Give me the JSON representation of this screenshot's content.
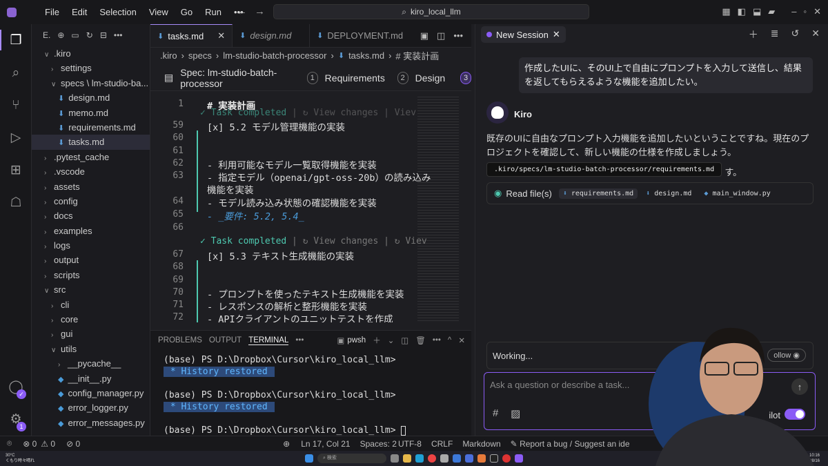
{
  "titlebar": {
    "menus": [
      "File",
      "Edit",
      "Selection",
      "View",
      "Go",
      "Run"
    ],
    "more": "•••",
    "search": "kiro_local_llm"
  },
  "explorer": {
    "header": "E.",
    "items": [
      {
        "label": ".kiro",
        "depth": 0,
        "chev": "∨"
      },
      {
        "label": "settings",
        "depth": 1,
        "chev": "›"
      },
      {
        "label": "specs \\ lm-studio-ba...",
        "depth": 1,
        "chev": "∨"
      },
      {
        "label": "design.md",
        "depth": 2,
        "icon": "md"
      },
      {
        "label": "memo.md",
        "depth": 2,
        "icon": "md"
      },
      {
        "label": "requirements.md",
        "depth": 2,
        "icon": "md"
      },
      {
        "label": "tasks.md",
        "depth": 2,
        "icon": "md",
        "selected": true
      },
      {
        "label": ".pytest_cache",
        "depth": 0,
        "chev": "›"
      },
      {
        "label": ".vscode",
        "depth": 0,
        "chev": "›"
      },
      {
        "label": "assets",
        "depth": 0,
        "chev": "›"
      },
      {
        "label": "config",
        "depth": 0,
        "chev": "›"
      },
      {
        "label": "docs",
        "depth": 0,
        "chev": "›"
      },
      {
        "label": "examples",
        "depth": 0,
        "chev": "›"
      },
      {
        "label": "logs",
        "depth": 0,
        "chev": "›"
      },
      {
        "label": "output",
        "depth": 0,
        "chev": "›"
      },
      {
        "label": "scripts",
        "depth": 0,
        "chev": "›"
      },
      {
        "label": "src",
        "depth": 0,
        "chev": "∨"
      },
      {
        "label": "cli",
        "depth": 1,
        "chev": "›"
      },
      {
        "label": "core",
        "depth": 1,
        "chev": "›"
      },
      {
        "label": "gui",
        "depth": 1,
        "chev": "›"
      },
      {
        "label": "utils",
        "depth": 1,
        "chev": "∨"
      },
      {
        "label": "__pycache__",
        "depth": 2,
        "chev": "›"
      },
      {
        "label": "__init__.py",
        "depth": 2,
        "icon": "py"
      },
      {
        "label": "config_manager.py",
        "depth": 2,
        "icon": "py"
      },
      {
        "label": "error_logger.py",
        "depth": 2,
        "icon": "py"
      },
      {
        "label": "error_messages.py",
        "depth": 2,
        "icon": "py"
      }
    ]
  },
  "tabs": [
    {
      "label": "tasks.md",
      "active": true,
      "close": "✕"
    },
    {
      "label": "design.md",
      "active": false,
      "italic": true
    },
    {
      "label": "DEPLOYMENT.md",
      "active": false
    }
  ],
  "breadcrumb": [
    ".kiro",
    "specs",
    "lm-studio-batch-processor",
    "tasks.md",
    "# 実装計画"
  ],
  "spec": {
    "label": "Spec: lm-studio-batch-processor",
    "steps": [
      {
        "num": "1",
        "label": "Requirements"
      },
      {
        "num": "2",
        "label": "Design"
      },
      {
        "num": "3",
        "label": ""
      }
    ]
  },
  "editor": {
    "task_completed": "Task completed",
    "view_changes": "View changes",
    "view_trunc": "Viev",
    "lines": [
      {
        "n": "1",
        "text": "# 実装計画"
      },
      {
        "n": "59",
        "text": "[x] 5.2 モデル管理機能の実装"
      },
      {
        "n": "60",
        "text": ""
      },
      {
        "n": "61",
        "text": ""
      },
      {
        "n": "62",
        "text": "- 利用可能なモデル一覧取得機能を実装"
      },
      {
        "n": "63",
        "text": "- 指定モデル（openai/gpt-oss-20b）の読み込み"
      },
      {
        "n": "",
        "text": "機能を実装"
      },
      {
        "n": "64",
        "text": "- モデル読み込み状態の確認機能を実装"
      },
      {
        "n": "65",
        "text": "- _要件: 5.2, 5.4_"
      },
      {
        "n": "66",
        "text": ""
      },
      {
        "n": "67",
        "text": "[x] 5.3 テキスト生成機能の実装"
      },
      {
        "n": "68",
        "text": ""
      },
      {
        "n": "69",
        "text": ""
      },
      {
        "n": "70",
        "text": "- プロンプトを使ったテキスト生成機能を実装"
      },
      {
        "n": "71",
        "text": "- レスポンスの解析と整形機能を実装"
      },
      {
        "n": "72",
        "text": "- APIクライアントのユニットテストを作成"
      }
    ]
  },
  "panel": {
    "tabs": [
      "PROBLEMS",
      "OUTPUT",
      "TERMINAL"
    ],
    "active": "TERMINAL",
    "shell": "pwsh",
    "terminal": [
      "(base) PS D:\\Dropbox\\Cursor\\kiro_local_llm>",
      "History restored",
      "",
      "(base) PS D:\\Dropbox\\Cursor\\kiro_local_llm>",
      "History restored",
      "",
      "(base) PS D:\\Dropbox\\Cursor\\kiro_local_llm> "
    ]
  },
  "chat": {
    "session_tab": "New Session",
    "user_message": "作成したUIに、そのUI上で自由にプロンプトを入力して送信し、結果を返してもらえるような機能を追加したい。",
    "assistant_name": "Kiro",
    "assistant_message": "既存のUIに自由なプロンプト入力機能を追加したいということですね。現在のプロジェクトを確認して、新しい機能の仕様を作成しましょう。",
    "tooltip": ".kiro/specs/lm-studio-batch-processor/requirements.md",
    "tooltip_tail": "す。",
    "read_files_label": "Read file(s)",
    "files": [
      "requirements.md",
      "design.md",
      "main_window.py"
    ],
    "working": "Working...",
    "follow": "ollow",
    "placeholder": "Ask a question or describe a task...",
    "bottom_left": "Cl",
    "bottom_right": "ilot"
  },
  "status": {
    "errors": "0",
    "warnings": "0",
    "ports": "0",
    "position": "Ln 17, Col 21",
    "spaces": "Spaces: 2",
    "encoding": "UTF-8",
    "eol": "CRLF",
    "lang": "Markdown",
    "report": "Report a bug / Suggest an ide"
  },
  "taskbar": {
    "weather": "30°C",
    "weather_sub": "くもり時々晴れ",
    "search": "検索",
    "time": "10:16",
    "date": "08/16"
  },
  "colors": {
    "accent": "#8b5cf6",
    "bg": "#1e1e22",
    "link": "#4a9bd9",
    "task": "#4ec9b0"
  }
}
